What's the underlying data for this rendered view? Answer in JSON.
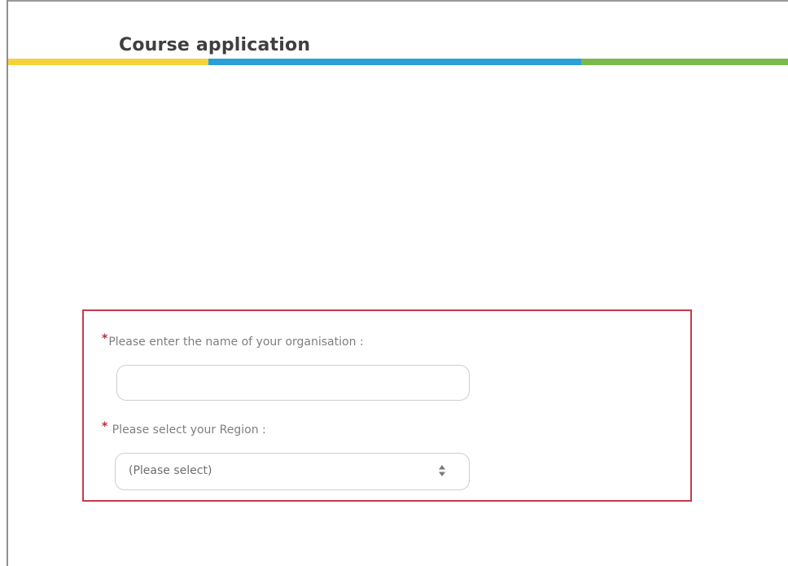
{
  "header": {
    "title": "Course application",
    "stripe_colors": [
      "#f4d33a",
      "#2a9fd8",
      "#79b94a"
    ]
  },
  "form": {
    "border_color": "#c63a4a",
    "required_marker": "*",
    "organisation": {
      "label": "Please enter the name of your organisation :",
      "value": ""
    },
    "region": {
      "label": "Please select your Region :",
      "selected": "(Please select)",
      "arrow_icon": "updown-arrows-icon"
    }
  }
}
